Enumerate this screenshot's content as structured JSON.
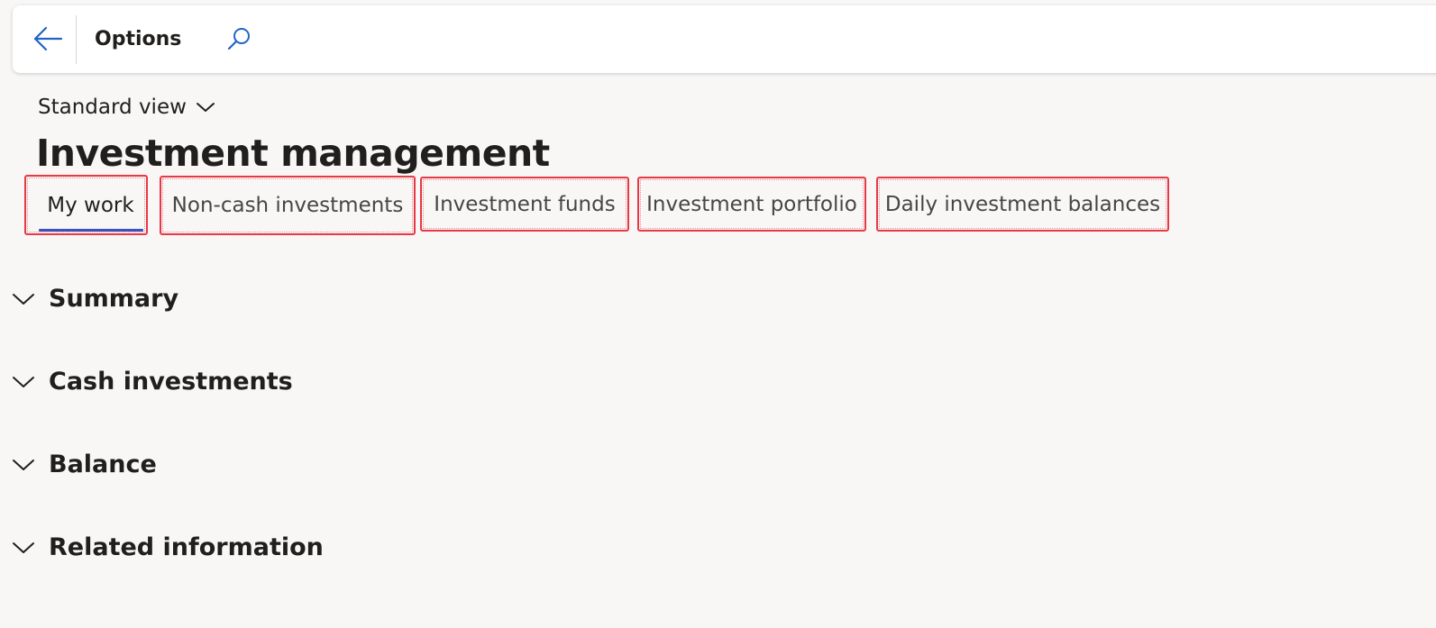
{
  "topbar": {
    "back_icon": "arrow-left-icon",
    "title": "Options",
    "search_icon": "search-icon"
  },
  "view_selector": {
    "label": "Standard view",
    "icon": "chevron-down-icon"
  },
  "page_title": "Investment management",
  "tabs": [
    {
      "label": "My work",
      "active": true
    },
    {
      "label": "Non-cash investments",
      "active": false
    },
    {
      "label": "Investment funds",
      "active": false
    },
    {
      "label": "Investment portfolio",
      "active": false
    },
    {
      "label": "Daily investment balances",
      "active": false
    }
  ],
  "sections": [
    {
      "label": "Summary",
      "collapsed_icon": "chevron-down-icon"
    },
    {
      "label": "Cash investments",
      "collapsed_icon": "chevron-down-icon"
    },
    {
      "label": "Balance",
      "collapsed_icon": "chevron-down-icon"
    },
    {
      "label": "Related information",
      "collapsed_icon": "chevron-down-icon"
    }
  ],
  "colors": {
    "accent": "#2264c8",
    "tab_underline": "#3d4fc4",
    "highlight_box": "#e63946",
    "background": "#f8f7f6"
  }
}
